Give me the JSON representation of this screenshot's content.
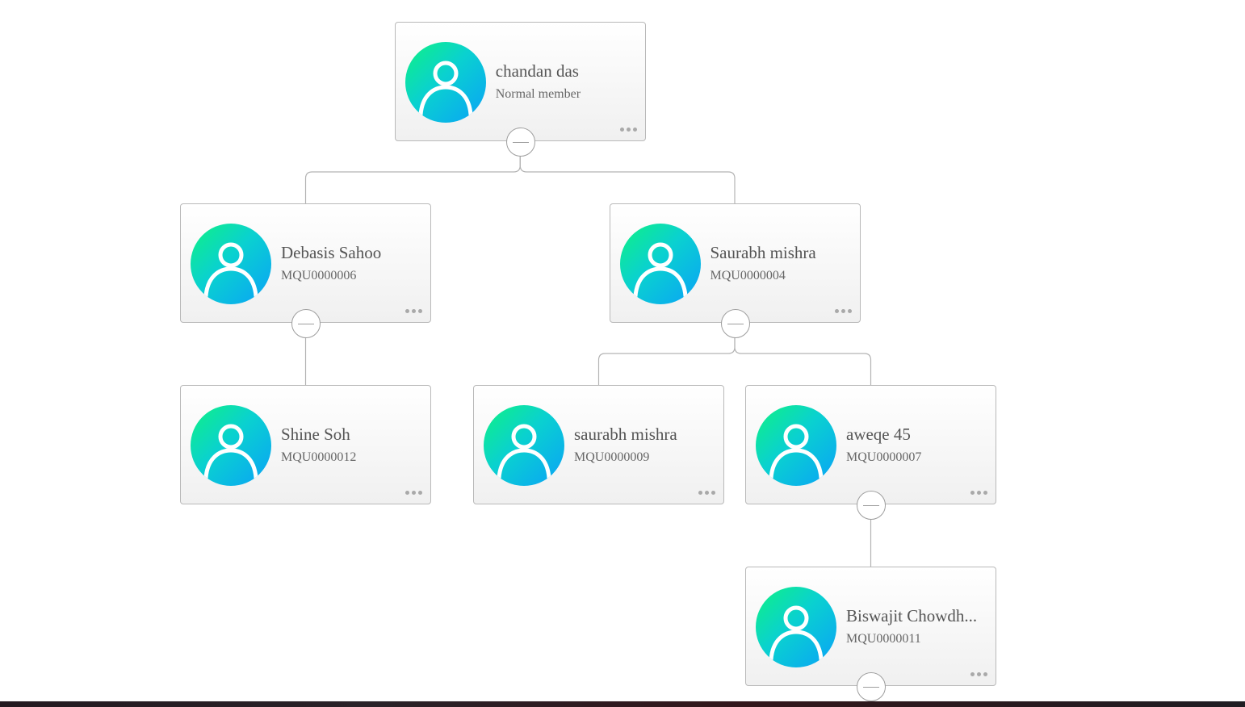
{
  "org_chart": {
    "root": {
      "name": "chandan das",
      "subtitle": "Normal member",
      "children": [
        {
          "name": "Debasis Sahoo",
          "subtitle": "MQU0000006",
          "children": [
            {
              "name": "Shine Soh",
              "subtitle": "MQU0000012",
              "children": []
            }
          ]
        },
        {
          "name": "Saurabh mishra",
          "subtitle": "MQU0000004",
          "children": [
            {
              "name": "saurabh mishra",
              "subtitle": "MQU0000009",
              "children": []
            },
            {
              "name": "aweqe 45",
              "subtitle": "MQU0000007",
              "children": [
                {
                  "name": "Biswajit Chowdh...",
                  "subtitle": "MQU0000011",
                  "children": [],
                  "has_collapse_toggle": true
                }
              ]
            }
          ]
        }
      ]
    }
  },
  "icons": {
    "avatar": "user-avatar-icon",
    "more": "more-options-icon",
    "collapse": "collapse-toggle-icon"
  },
  "colors": {
    "avatar_gradient": [
      "#0ff282",
      "#0ad1d0",
      "#0aa2f7"
    ],
    "node_border": "#b9b9b9",
    "connector": "#b3b3b3",
    "text": "#555555"
  }
}
